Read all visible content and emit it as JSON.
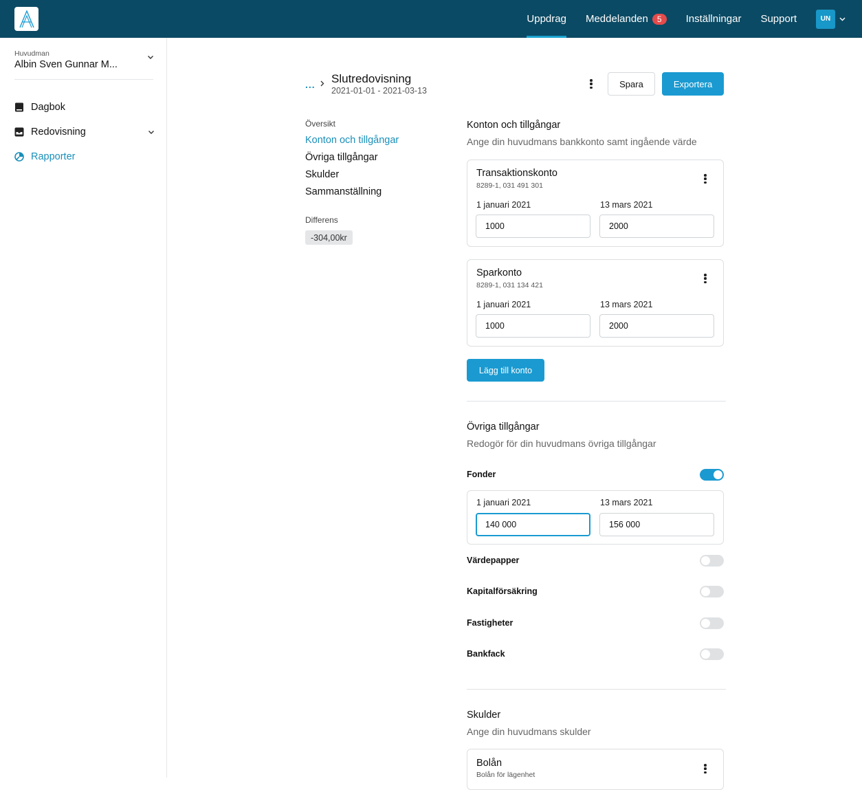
{
  "topbar": {
    "nav": [
      {
        "label": "Uppdrag",
        "active": true
      },
      {
        "label": "Meddelanden",
        "badge": "5"
      },
      {
        "label": "Inställningar"
      },
      {
        "label": "Support"
      }
    ],
    "user_initials": "UN"
  },
  "sidebar": {
    "principal_label": "Huvudman",
    "principal_name": "Albin Sven Gunnar M...",
    "items": [
      {
        "label": "Dagbok",
        "icon": "book-icon"
      },
      {
        "label": "Redovisning",
        "icon": "inbox-icon",
        "expandable": true
      },
      {
        "label": "Rapporter",
        "icon": "pie-chart-icon",
        "active": true
      }
    ]
  },
  "header": {
    "breadcrumb_ellipsis": "...",
    "title": "Slutredovisning",
    "date_range": "2021-01-01 - 2021-03-13",
    "save_label": "Spara",
    "export_label": "Exportera"
  },
  "toc": {
    "label": "Översikt",
    "items": [
      "Konton och tillgångar",
      "Övriga tillgångar",
      "Skulder",
      "Sammanställning"
    ],
    "active_index": 0,
    "difference_label": "Differens",
    "difference_value": "-304,00kr"
  },
  "accounts": {
    "title": "Konton och tillgångar",
    "subtitle": "Ange din huvudmans bankkonto samt ingående värde",
    "cards": [
      {
        "name": "Transaktionskonto",
        "number": "8289-1, 031 491 301",
        "start_label": "1 januari 2021",
        "end_label": "13 mars 2021",
        "start_value": "1000",
        "end_value": "2000"
      },
      {
        "name": "Sparkonto",
        "number": "8289-1, 031 134 421",
        "start_label": "1 januari 2021",
        "end_label": "13 mars 2021",
        "start_value": "1000",
        "end_value": "2000"
      }
    ],
    "add_label": "Lägg till konto"
  },
  "other_assets": {
    "title": "Övriga tillgångar",
    "subtitle": "Redogör för din huvudmans övriga tillgångar",
    "funds": {
      "label": "Fonder",
      "on": true,
      "start_label": "1 januari 2021",
      "end_label": "13 mars 2021",
      "start_value": "140 000",
      "end_value": "156 000"
    },
    "toggles": [
      {
        "label": "Värdepapper",
        "on": false
      },
      {
        "label": "Kapitalförsäkring",
        "on": false
      },
      {
        "label": "Fastigheter",
        "on": false
      },
      {
        "label": "Bankfack",
        "on": false
      }
    ]
  },
  "debts": {
    "title": "Skulder",
    "subtitle": "Ange din huvudmans skulder",
    "cards": [
      {
        "name": "Bolån",
        "description": "Bolån för lägenhet"
      }
    ]
  }
}
